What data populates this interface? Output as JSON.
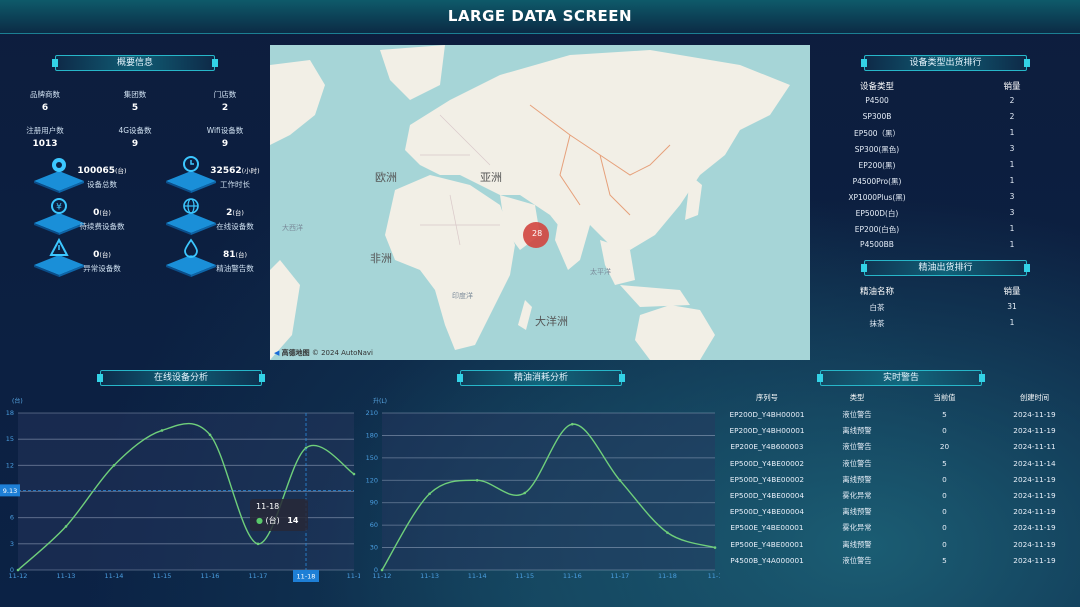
{
  "header": {
    "title": "LARGE DATA SCREEN"
  },
  "overview": {
    "title": "概要信息",
    "stats": [
      {
        "label": "品牌商数",
        "value": "6"
      },
      {
        "label": "集团数",
        "value": "5"
      },
      {
        "label": "门店数",
        "value": "2"
      },
      {
        "label": "注册用户数",
        "value": "1013"
      },
      {
        "label": "4G设备数",
        "value": "9"
      },
      {
        "label": "Wifi设备数",
        "value": "9"
      }
    ],
    "big": [
      {
        "icon": "gear-icon",
        "value": "100065",
        "unit": "(台)",
        "label": "设备总数"
      },
      {
        "icon": "clock-icon",
        "value": "32562",
        "unit": "(小时)",
        "label": "工作时长"
      },
      {
        "icon": "yen-icon",
        "value": "0",
        "unit": "(台)",
        "label": "待续费设备数"
      },
      {
        "icon": "globe-icon",
        "value": "2",
        "unit": "(台)",
        "label": "在线设备数"
      },
      {
        "icon": "warning-icon",
        "value": "0",
        "unit": "(台)",
        "label": "异常设备数"
      },
      {
        "icon": "oil-drop-icon",
        "value": "81",
        "unit": "(台)",
        "label": "精油警告数"
      }
    ]
  },
  "map": {
    "cluster_count": "28",
    "labels": [
      "欧洲",
      "亚洲",
      "非洲",
      "大洋洲",
      "大西洋",
      "印度洋",
      "太平洋"
    ],
    "attribution": "高德地图",
    "copyright": "© 2024 AutoNavi"
  },
  "device_rank": {
    "title": "设备类型出货排行",
    "col1": "设备类型",
    "col2": "销量",
    "rows": [
      [
        "P4500",
        "2"
      ],
      [
        "SP300B",
        "2"
      ],
      [
        "EP500（黑）",
        "1"
      ],
      [
        "SP300(黑色)",
        "3"
      ],
      [
        "EP200(黑)",
        "1"
      ],
      [
        "P4500Pro(黑)",
        "1"
      ],
      [
        "XP1000Plus(黑)",
        "3"
      ],
      [
        "EP500D(白)",
        "3"
      ],
      [
        "EP200(白色)",
        "1"
      ],
      [
        "P4500BB",
        "1"
      ]
    ]
  },
  "oil_rank": {
    "title": "精油出货排行",
    "col1": "精油名称",
    "col2": "销量",
    "rows": [
      [
        "白茶",
        "31"
      ],
      [
        "抹茶",
        "1"
      ]
    ]
  },
  "online_chart": {
    "title": "在线设备分析",
    "unit": "(台)",
    "tooltip": {
      "date": "11-18",
      "label": "(台)",
      "value": "14"
    },
    "pointer": "9.13",
    "active_tick": "11-18"
  },
  "oil_chart": {
    "title": "精油消耗分析",
    "unit": "升(L)"
  },
  "alerts": {
    "title": "实时警告",
    "cols": [
      "序列号",
      "类型",
      "当前值",
      "创建时间"
    ],
    "rows": [
      [
        "EP200D_Y4BH00001",
        "液位警告",
        "5",
        "2024-11-19"
      ],
      [
        "EP200D_Y4BH00001",
        "离线预警",
        "0",
        "2024-11-19"
      ],
      [
        "EP200E_Y4B600003",
        "液位警告",
        "20",
        "2024-11-11"
      ],
      [
        "EP500D_Y4BE00002",
        "液位警告",
        "5",
        "2024-11-14"
      ],
      [
        "EP500D_Y4BE00002",
        "离线预警",
        "0",
        "2024-11-19"
      ],
      [
        "EP500D_Y4BE00004",
        "雾化异常",
        "0",
        "2024-11-19"
      ],
      [
        "EP500D_Y4BE00004",
        "离线预警",
        "0",
        "2024-11-19"
      ],
      [
        "EP500E_Y4BE00001",
        "雾化异常",
        "0",
        "2024-11-19"
      ],
      [
        "EP500E_Y4BE00001",
        "离线预警",
        "0",
        "2024-11-19"
      ],
      [
        "P4500B_Y4A000001",
        "液位警告",
        "5",
        "2024-11-19"
      ]
    ]
  },
  "chart_data": [
    {
      "type": "line",
      "x": [
        "11-12",
        "11-13",
        "11-14",
        "11-15",
        "11-16",
        "11-17",
        "11-18",
        "11-1"
      ],
      "values": [
        0,
        5,
        12,
        16,
        15.5,
        3,
        14,
        11
      ],
      "ylim": [
        0,
        18
      ],
      "yticks": [
        0,
        3,
        6,
        9,
        12,
        15,
        18
      ],
      "ylabel": "(台)"
    },
    {
      "type": "line",
      "x": [
        "11-12",
        "11-13",
        "11-14",
        "11-15",
        "11-16",
        "11-17",
        "11-18",
        "11-1"
      ],
      "values": [
        0,
        102,
        120,
        103,
        195,
        120,
        50,
        30
      ],
      "ylim": [
        0,
        210
      ],
      "yticks": [
        0,
        30,
        60,
        90,
        120,
        150,
        180,
        210
      ],
      "ylabel": "升(L)"
    }
  ]
}
